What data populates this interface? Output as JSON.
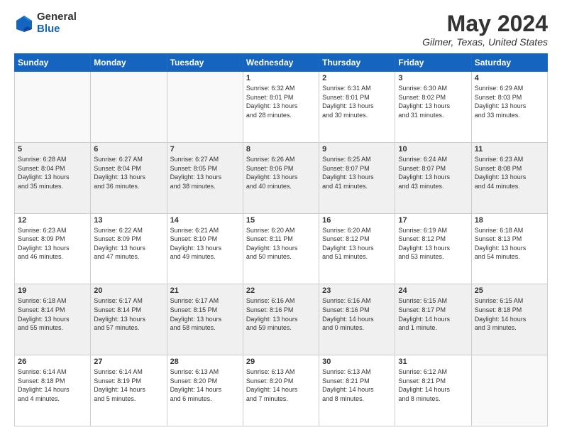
{
  "header": {
    "logo_line1": "General",
    "logo_line2": "Blue",
    "month": "May 2024",
    "location": "Gilmer, Texas, United States"
  },
  "days_of_week": [
    "Sunday",
    "Monday",
    "Tuesday",
    "Wednesday",
    "Thursday",
    "Friday",
    "Saturday"
  ],
  "weeks": [
    {
      "shaded": false,
      "days": [
        {
          "num": "",
          "info": ""
        },
        {
          "num": "",
          "info": ""
        },
        {
          "num": "",
          "info": ""
        },
        {
          "num": "1",
          "info": "Sunrise: 6:32 AM\nSunset: 8:01 PM\nDaylight: 13 hours\nand 28 minutes."
        },
        {
          "num": "2",
          "info": "Sunrise: 6:31 AM\nSunset: 8:01 PM\nDaylight: 13 hours\nand 30 minutes."
        },
        {
          "num": "3",
          "info": "Sunrise: 6:30 AM\nSunset: 8:02 PM\nDaylight: 13 hours\nand 31 minutes."
        },
        {
          "num": "4",
          "info": "Sunrise: 6:29 AM\nSunset: 8:03 PM\nDaylight: 13 hours\nand 33 minutes."
        }
      ]
    },
    {
      "shaded": true,
      "days": [
        {
          "num": "5",
          "info": "Sunrise: 6:28 AM\nSunset: 8:04 PM\nDaylight: 13 hours\nand 35 minutes."
        },
        {
          "num": "6",
          "info": "Sunrise: 6:27 AM\nSunset: 8:04 PM\nDaylight: 13 hours\nand 36 minutes."
        },
        {
          "num": "7",
          "info": "Sunrise: 6:27 AM\nSunset: 8:05 PM\nDaylight: 13 hours\nand 38 minutes."
        },
        {
          "num": "8",
          "info": "Sunrise: 6:26 AM\nSunset: 8:06 PM\nDaylight: 13 hours\nand 40 minutes."
        },
        {
          "num": "9",
          "info": "Sunrise: 6:25 AM\nSunset: 8:07 PM\nDaylight: 13 hours\nand 41 minutes."
        },
        {
          "num": "10",
          "info": "Sunrise: 6:24 AM\nSunset: 8:07 PM\nDaylight: 13 hours\nand 43 minutes."
        },
        {
          "num": "11",
          "info": "Sunrise: 6:23 AM\nSunset: 8:08 PM\nDaylight: 13 hours\nand 44 minutes."
        }
      ]
    },
    {
      "shaded": false,
      "days": [
        {
          "num": "12",
          "info": "Sunrise: 6:23 AM\nSunset: 8:09 PM\nDaylight: 13 hours\nand 46 minutes."
        },
        {
          "num": "13",
          "info": "Sunrise: 6:22 AM\nSunset: 8:09 PM\nDaylight: 13 hours\nand 47 minutes."
        },
        {
          "num": "14",
          "info": "Sunrise: 6:21 AM\nSunset: 8:10 PM\nDaylight: 13 hours\nand 49 minutes."
        },
        {
          "num": "15",
          "info": "Sunrise: 6:20 AM\nSunset: 8:11 PM\nDaylight: 13 hours\nand 50 minutes."
        },
        {
          "num": "16",
          "info": "Sunrise: 6:20 AM\nSunset: 8:12 PM\nDaylight: 13 hours\nand 51 minutes."
        },
        {
          "num": "17",
          "info": "Sunrise: 6:19 AM\nSunset: 8:12 PM\nDaylight: 13 hours\nand 53 minutes."
        },
        {
          "num": "18",
          "info": "Sunrise: 6:18 AM\nSunset: 8:13 PM\nDaylight: 13 hours\nand 54 minutes."
        }
      ]
    },
    {
      "shaded": true,
      "days": [
        {
          "num": "19",
          "info": "Sunrise: 6:18 AM\nSunset: 8:14 PM\nDaylight: 13 hours\nand 55 minutes."
        },
        {
          "num": "20",
          "info": "Sunrise: 6:17 AM\nSunset: 8:14 PM\nDaylight: 13 hours\nand 57 minutes."
        },
        {
          "num": "21",
          "info": "Sunrise: 6:17 AM\nSunset: 8:15 PM\nDaylight: 13 hours\nand 58 minutes."
        },
        {
          "num": "22",
          "info": "Sunrise: 6:16 AM\nSunset: 8:16 PM\nDaylight: 13 hours\nand 59 minutes."
        },
        {
          "num": "23",
          "info": "Sunrise: 6:16 AM\nSunset: 8:16 PM\nDaylight: 14 hours\nand 0 minutes."
        },
        {
          "num": "24",
          "info": "Sunrise: 6:15 AM\nSunset: 8:17 PM\nDaylight: 14 hours\nand 1 minute."
        },
        {
          "num": "25",
          "info": "Sunrise: 6:15 AM\nSunset: 8:18 PM\nDaylight: 14 hours\nand 3 minutes."
        }
      ]
    },
    {
      "shaded": false,
      "days": [
        {
          "num": "26",
          "info": "Sunrise: 6:14 AM\nSunset: 8:18 PM\nDaylight: 14 hours\nand 4 minutes."
        },
        {
          "num": "27",
          "info": "Sunrise: 6:14 AM\nSunset: 8:19 PM\nDaylight: 14 hours\nand 5 minutes."
        },
        {
          "num": "28",
          "info": "Sunrise: 6:13 AM\nSunset: 8:20 PM\nDaylight: 14 hours\nand 6 minutes."
        },
        {
          "num": "29",
          "info": "Sunrise: 6:13 AM\nSunset: 8:20 PM\nDaylight: 14 hours\nand 7 minutes."
        },
        {
          "num": "30",
          "info": "Sunrise: 6:13 AM\nSunset: 8:21 PM\nDaylight: 14 hours\nand 8 minutes."
        },
        {
          "num": "31",
          "info": "Sunrise: 6:12 AM\nSunset: 8:21 PM\nDaylight: 14 hours\nand 8 minutes."
        },
        {
          "num": "",
          "info": ""
        }
      ]
    }
  ]
}
